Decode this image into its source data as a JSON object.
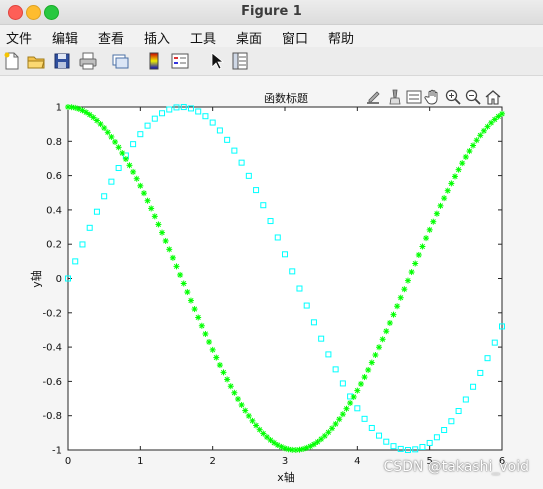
{
  "window": {
    "title": "Figure 1"
  },
  "menu": [
    "文件",
    "编辑",
    "查看",
    "插入",
    "工具",
    "桌面",
    "窗口",
    "帮助"
  ],
  "toolbar_icons": [
    "new-figure-icon",
    "open-folder-icon",
    "save-icon",
    "print-icon",
    "link-icon",
    "colorbar-icon",
    "legend-icon",
    "pointer-icon",
    "property-inspector-icon"
  ],
  "axes_toolbar_icons": [
    "export-icon",
    "brush-icon",
    "data-tips-icon",
    "pan-hand-icon",
    "zoom-in-icon",
    "zoom-out-icon",
    "home-icon"
  ],
  "watermark": "CSDN @takashi_void",
  "chart_data": {
    "type": "scatter",
    "title": "函数标题",
    "xlabel": "x轴",
    "ylabel": "y轴",
    "xlim": [
      0,
      6
    ],
    "ylim": [
      -1,
      1
    ],
    "xticks": [
      "0",
      "1",
      "2",
      "3",
      "4",
      "5",
      "6"
    ],
    "yticks": [
      "-1",
      "-0.8",
      "-0.6",
      "-0.4",
      "-0.2",
      "0",
      "0.2",
      "0.4",
      "0.6",
      "0.8",
      "1"
    ],
    "grid": false,
    "series": [
      {
        "function": "sin(x)",
        "marker": "square",
        "color": "#00ffff",
        "x_start": 0,
        "x_end": 6,
        "x_step": 0.1
      },
      {
        "function": "cos(x)",
        "marker": "asterisk",
        "color": "#00ff00",
        "x_start": 0,
        "x_end": 6,
        "x_step": 0.05
      }
    ]
  }
}
